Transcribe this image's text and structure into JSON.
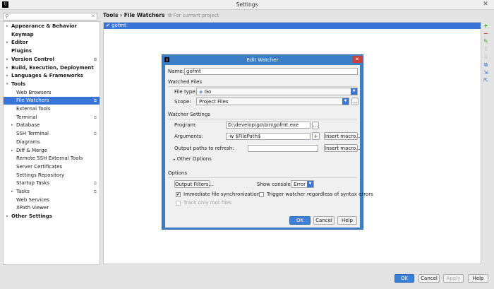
{
  "window": {
    "title": "Settings"
  },
  "sidebar": {
    "items": [
      {
        "label": "Appearance & Behavior",
        "bold": true,
        "level": 0,
        "arrow": "▸",
        "copy": false,
        "selected": false
      },
      {
        "label": "Keymap",
        "bold": true,
        "level": 0,
        "arrow": "",
        "copy": false,
        "selected": false
      },
      {
        "label": "Editor",
        "bold": true,
        "level": 0,
        "arrow": "▸",
        "copy": false,
        "selected": false
      },
      {
        "label": "Plugins",
        "bold": true,
        "level": 0,
        "arrow": "",
        "copy": false,
        "selected": false
      },
      {
        "label": "Version Control",
        "bold": true,
        "level": 0,
        "arrow": "▸",
        "copy": true,
        "selected": false
      },
      {
        "label": "Build, Execution, Deployment",
        "bold": true,
        "level": 0,
        "arrow": "▸",
        "copy": false,
        "selected": false
      },
      {
        "label": "Languages & Frameworks",
        "bold": true,
        "level": 0,
        "arrow": "▸",
        "copy": false,
        "selected": false
      },
      {
        "label": "Tools",
        "bold": true,
        "level": 0,
        "arrow": "▾",
        "copy": false,
        "selected": false
      },
      {
        "label": "Web Browsers",
        "bold": false,
        "level": 1,
        "arrow": "",
        "copy": false,
        "selected": false
      },
      {
        "label": "File Watchers",
        "bold": false,
        "level": 1,
        "arrow": "",
        "copy": true,
        "selected": true
      },
      {
        "label": "External Tools",
        "bold": false,
        "level": 1,
        "arrow": "",
        "copy": false,
        "selected": false
      },
      {
        "label": "Terminal",
        "bold": false,
        "level": 1,
        "arrow": "",
        "copy": true,
        "selected": false
      },
      {
        "label": "Database",
        "bold": false,
        "level": 1,
        "arrow": "▸",
        "copy": false,
        "selected": false
      },
      {
        "label": "SSH Terminal",
        "bold": false,
        "level": 1,
        "arrow": "",
        "copy": true,
        "selected": false
      },
      {
        "label": "Diagrams",
        "bold": false,
        "level": 1,
        "arrow": "",
        "copy": false,
        "selected": false
      },
      {
        "label": "Diff & Merge",
        "bold": false,
        "level": 1,
        "arrow": "▸",
        "copy": false,
        "selected": false
      },
      {
        "label": "Remote SSH External Tools",
        "bold": false,
        "level": 1,
        "arrow": "",
        "copy": false,
        "selected": false
      },
      {
        "label": "Server Certificates",
        "bold": false,
        "level": 1,
        "arrow": "",
        "copy": false,
        "selected": false
      },
      {
        "label": "Settings Repository",
        "bold": false,
        "level": 1,
        "arrow": "",
        "copy": false,
        "selected": false
      },
      {
        "label": "Startup Tasks",
        "bold": false,
        "level": 1,
        "arrow": "",
        "copy": true,
        "selected": false
      },
      {
        "label": "Tasks",
        "bold": false,
        "level": 1,
        "arrow": "▸",
        "copy": true,
        "selected": false
      },
      {
        "label": "Web Services",
        "bold": false,
        "level": 1,
        "arrow": "",
        "copy": false,
        "selected": false
      },
      {
        "label": "XPath Viewer",
        "bold": false,
        "level": 1,
        "arrow": "",
        "copy": false,
        "selected": false
      },
      {
        "label": "Other Settings",
        "bold": true,
        "level": 0,
        "arrow": "▸",
        "copy": false,
        "selected": false
      }
    ]
  },
  "breadcrumb": {
    "path": "Tools › File Watchers",
    "scope_note": "For current project"
  },
  "watchers": {
    "rows": [
      {
        "checked": "✔",
        "name": "gofmt"
      }
    ]
  },
  "toolbar": {
    "add": "+",
    "remove": "−",
    "edit": "✎",
    "up": "⇧",
    "down": "⇩",
    "copy": "⧉",
    "import": "⇲",
    "export": "⇱"
  },
  "dialog": {
    "title": "Edit Watcher",
    "close": "✕",
    "name_label": "Name:",
    "name_value": "gofmt",
    "watched_files_title": "Watched Files",
    "file_type_label": "File type:",
    "file_type_value": "Go",
    "scope_label": "Scope:",
    "scope_value": "Project Files",
    "scope_more": "...",
    "watcher_settings_title": "Watcher Settings",
    "program_label": "Program:",
    "program_value": "D:\\develop\\go\\bin\\gofmt.exe",
    "program_browse": "...",
    "arguments_label": "Arguments:",
    "arguments_value": "-w $FilePath$",
    "arguments_expand": "+",
    "insert_macro": "Insert macro...",
    "output_paths_label": "Output paths to refresh:",
    "output_paths_value": "",
    "insert_macro_2": "Insert macro...",
    "other_options": "Other Options",
    "options_title": "Options",
    "output_filters": "Output Filters...",
    "show_console_label": "Show console:",
    "show_console_value": "Error",
    "immediate_sync": "Immediate file synchronization",
    "immediate_sync_checked": "✔",
    "trigger_watcher": "Trigger watcher regardless of syntax errors",
    "track_root": "Track only root files",
    "ok": "OK",
    "cancel": "Cancel",
    "help": "Help"
  },
  "footer": {
    "ok": "OK",
    "cancel": "Cancel",
    "apply": "Apply",
    "help": "Help"
  },
  "colors": {
    "selection": "#3875d6",
    "dialog_frame": "#3b7ec6",
    "close_red": "#c7423a",
    "add_green": "#3d9a2f",
    "remove_red": "#d23b3b"
  }
}
